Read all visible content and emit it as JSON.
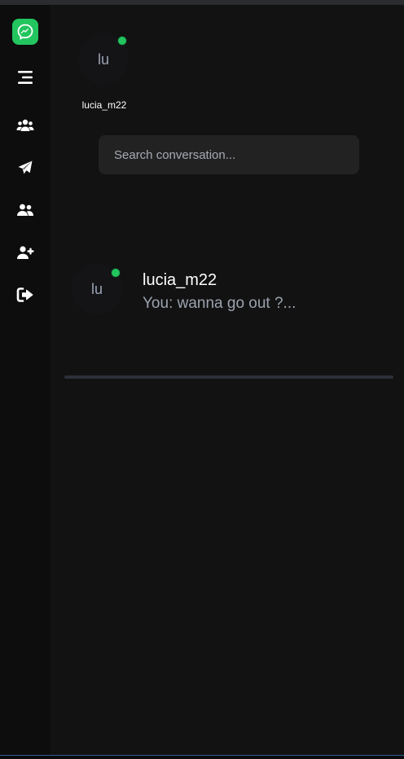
{
  "sidebar": {
    "logo_icon": "messenger-icon",
    "items": [
      {
        "icon": "menu-icon"
      },
      {
        "icon": "users-group-icon"
      },
      {
        "icon": "paper-plane-icon"
      },
      {
        "icon": "user-friends-icon"
      },
      {
        "icon": "user-plus-icon"
      },
      {
        "icon": "sign-out-icon"
      }
    ]
  },
  "online_users": [
    {
      "initials": "lu",
      "username": "lucia_m22",
      "online": true
    }
  ],
  "search": {
    "placeholder": "Search conversation..."
  },
  "conversations": [
    {
      "initials": "lu",
      "name": "lucia_m22",
      "preview": "You: wanna go out ?...",
      "online": true
    }
  ],
  "colors": {
    "accent": "#22c55e",
    "background": "#121212",
    "sidebar": "#0d0d0d"
  }
}
